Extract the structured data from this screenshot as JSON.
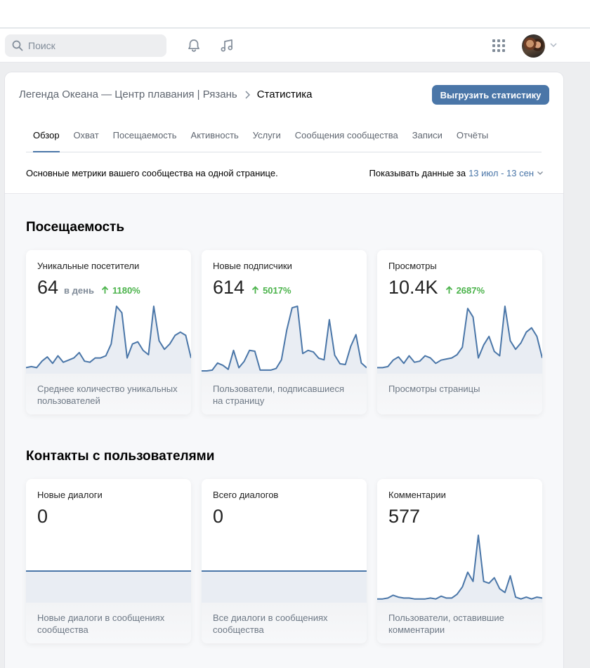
{
  "header": {
    "search_placeholder": "Поиск",
    "icons": [
      "search-icon",
      "bell-icon",
      "music-icon",
      "apps-grid-icon",
      "avatar",
      "chevron-down-icon"
    ]
  },
  "page": {
    "breadcrumb_parent": "Легенда Океана — Центр плавания | Рязань",
    "breadcrumb_current": "Статистика",
    "export_label": "Выгрузить статистику",
    "tabs": [
      "Обзор",
      "Охват",
      "Посещаемость",
      "Активность",
      "Услуги",
      "Сообщения сообщества",
      "Записи",
      "Отчёты"
    ],
    "active_tab": "Обзор",
    "description": "Основные метрики вашего сообщества на одной странице.",
    "period_label": "Показывать данные за",
    "period_range": "13 июл - 13 сен"
  },
  "colors": {
    "accent": "#4a76a8",
    "growth": "#4bb34b",
    "line": "#4a76a8",
    "area": "#e9edf3"
  },
  "sections": [
    {
      "title": "Посещаемость",
      "cards": [
        {
          "label": "Уникальные посетители",
          "value": "64",
          "per": "в день",
          "growth": "1180%",
          "description": "Среднее количество уникальных пользователей",
          "series": [
            3,
            4,
            3,
            9,
            13,
            7,
            14,
            8,
            10,
            12,
            17,
            9,
            8,
            12,
            12,
            14,
            25,
            60,
            54,
            12,
            25,
            27,
            19,
            15,
            60,
            28,
            20,
            25,
            33,
            36,
            33,
            12
          ]
        },
        {
          "label": "Новые подписчики",
          "value": "614",
          "per": "",
          "growth": "5017%",
          "description": "Пользователи, подписавшиеся на страницу",
          "series": [
            0,
            0,
            1,
            10,
            7,
            2,
            26,
            4,
            12,
            26,
            25,
            1,
            1,
            1,
            3,
            14,
            52,
            80,
            82,
            22,
            26,
            24,
            16,
            14,
            65,
            20,
            9,
            8,
            31,
            46,
            10,
            4
          ]
        },
        {
          "label": "Просмотры",
          "value": "10.4K",
          "per": "",
          "growth": "2687%",
          "description": "Просмотры страницы",
          "series": [
            3,
            3,
            4,
            10,
            13,
            7,
            14,
            8,
            9,
            14,
            12,
            7,
            10,
            11,
            12,
            15,
            22,
            58,
            50,
            12,
            24,
            32,
            18,
            14,
            60,
            28,
            20,
            26,
            36,
            40,
            32,
            12
          ]
        }
      ]
    },
    {
      "title": "Контакты с пользователями",
      "cards": [
        {
          "label": "Новые диалоги",
          "value": "0",
          "per": "",
          "growth": "",
          "description": "Новые диалоги в сообщениях сообщества",
          "series": [
            0,
            0,
            0,
            0,
            0,
            0,
            0,
            0,
            0,
            0,
            0,
            0,
            0,
            0,
            0,
            0,
            0,
            0,
            0,
            0,
            0,
            0,
            0,
            0,
            0,
            0,
            0,
            0,
            0,
            0,
            0,
            0
          ]
        },
        {
          "label": "Всего диалогов",
          "value": "0",
          "per": "",
          "growth": "",
          "description": "Все диалоги в сообщениях сообщества",
          "series": [
            0,
            0,
            0,
            0,
            0,
            0,
            0,
            0,
            0,
            0,
            0,
            0,
            0,
            0,
            0,
            0,
            0,
            0,
            0,
            0,
            0,
            0,
            0,
            0,
            0,
            0,
            0,
            0,
            0,
            0,
            0,
            0
          ]
        },
        {
          "label": "Комментарии",
          "value": "577",
          "per": "",
          "growth": "",
          "description": "Пользователи, оставившие комментарии",
          "series": [
            1,
            1,
            2,
            5,
            3,
            2,
            2,
            1,
            1,
            1,
            2,
            1,
            4,
            2,
            2,
            6,
            14,
            30,
            20,
            70,
            20,
            18,
            24,
            12,
            8,
            26,
            3,
            1,
            3,
            1,
            3,
            2
          ]
        }
      ]
    }
  ]
}
